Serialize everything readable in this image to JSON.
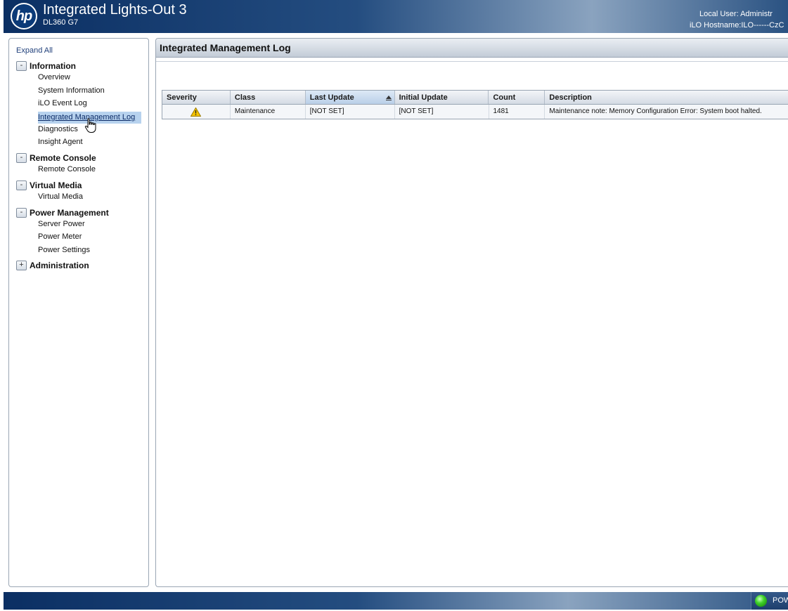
{
  "header": {
    "logo_text": "hp",
    "title": "Integrated Lights-Out 3",
    "model": "DL360 G7",
    "local_user_text": "Local User:  Administr",
    "hostname_text": "iLO Hostname:ILO------CzC"
  },
  "sidebar": {
    "expand_all": "Expand All",
    "groups": [
      {
        "label": "Information",
        "toggle": "-",
        "items": [
          "Overview",
          "System Information",
          "iLO Event Log",
          "Integrated Management Log",
          "Diagnostics",
          "Insight Agent"
        ]
      },
      {
        "label": "Remote Console",
        "toggle": "-",
        "items": [
          "Remote Console"
        ]
      },
      {
        "label": "Virtual Media",
        "toggle": "-",
        "items": [
          "Virtual Media"
        ]
      },
      {
        "label": "Power Management",
        "toggle": "-",
        "items": [
          "Server Power",
          "Power Meter",
          "Power Settings"
        ]
      },
      {
        "label": "Administration",
        "toggle": "+",
        "items": []
      }
    ],
    "active_item": "Integrated Management Log"
  },
  "main": {
    "title": "Integrated Management Log",
    "table": {
      "columns": [
        "Severity",
        "Class",
        "Last Update",
        "Initial Update",
        "Count",
        "Description"
      ],
      "sorted_column": "Last Update",
      "rows": [
        {
          "severity": "warning-icon",
          "class": "Maintenance",
          "last_update": "[NOT SET]",
          "initial_update": "[NOT SET]",
          "count": "1481",
          "description": "Maintenance note: Memory Configuration Error: System boot halted."
        }
      ]
    }
  },
  "footer": {
    "power_label": "POW",
    "power_status_color": "#3fd128"
  },
  "colors": {
    "header_dark": "#0b2f63",
    "header_light": "#8aa3bf",
    "active_nav_bg": "#b7d2ee",
    "warning_yellow": "#f5c400"
  }
}
